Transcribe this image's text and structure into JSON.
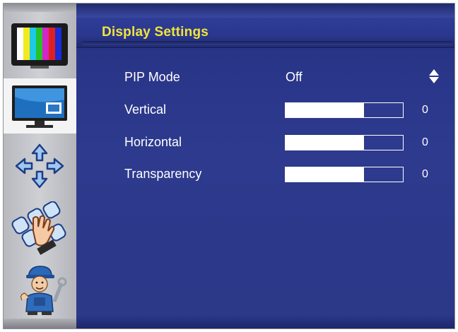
{
  "header": {
    "title": "Display Settings"
  },
  "sidebar": {
    "items": [
      {
        "icon": "color-bars-tv-icon",
        "active": false
      },
      {
        "icon": "pip-monitor-icon",
        "active": true
      },
      {
        "icon": "position-arrows-icon",
        "active": false
      },
      {
        "icon": "keypad-hand-icon",
        "active": false
      },
      {
        "icon": "technician-icon",
        "active": false
      }
    ]
  },
  "settings": {
    "pip_mode": {
      "label": "PIP Mode",
      "value": "Off"
    },
    "vertical": {
      "label": "Vertical",
      "value": "0",
      "level": 0.67
    },
    "horizontal": {
      "label": "Horizontal",
      "value": "0",
      "level": 0.67
    },
    "transparency": {
      "label": "Transparency",
      "value": "0",
      "level": 0.67
    }
  },
  "colors": {
    "background": "#2d3a8e",
    "title": "#f2e43a",
    "text": "#ffffff"
  }
}
